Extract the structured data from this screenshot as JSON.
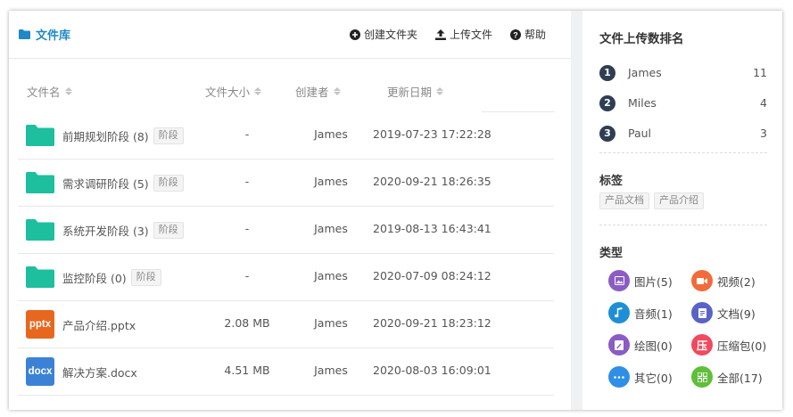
{
  "header": {
    "title": "文件库",
    "actions": {
      "create_folder": "创建文件夹",
      "upload": "上传文件",
      "help": "帮助"
    }
  },
  "table": {
    "columns": {
      "name": "文件名",
      "size": "文件大小",
      "owner": "创建者",
      "date": "更新日期"
    },
    "rows": [
      {
        "name": "前期规划阶段 (8)",
        "tag": "阶段",
        "size": "-",
        "owner": "James",
        "date": "2019-07-23 17:22:28",
        "icon": "folder-icon"
      },
      {
        "name": "需求调研阶段 (5)",
        "tag": "阶段",
        "size": "-",
        "owner": "James",
        "date": "2020-09-21 18:26:35",
        "icon": "folder-icon"
      },
      {
        "name": "系统开发阶段 (3)",
        "tag": "阶段",
        "size": "-",
        "owner": "James",
        "date": "2019-08-13 16:43:41",
        "icon": "folder-icon"
      },
      {
        "name": "监控阶段 (0)",
        "tag": "阶段",
        "size": "-",
        "owner": "James",
        "date": "2020-07-09 08:24:12",
        "icon": "folder-icon"
      },
      {
        "name": "产品介绍.pptx",
        "badge": "pptx",
        "size": "2.08 MB",
        "owner": "James",
        "date": "2020-09-21 18:23:12",
        "icon": "pptx-file-icon"
      },
      {
        "name": "解决方案.docx",
        "badge": "docx",
        "size": "4.51 MB",
        "owner": "James",
        "date": "2020-08-03 16:09:01",
        "icon": "docx-file-icon"
      }
    ]
  },
  "sidebar": {
    "ranking_title": "文件上传数排名",
    "ranking": [
      {
        "rank": "1",
        "name": "James",
        "count": "11"
      },
      {
        "rank": "2",
        "name": "Miles",
        "count": "4"
      },
      {
        "rank": "3",
        "name": "Paul",
        "count": "3"
      }
    ],
    "tags_title": "标签",
    "tags": [
      "产品文档",
      "产品介绍"
    ],
    "types_title": "类型",
    "types": [
      {
        "label": "图片(5)",
        "icon": "image-icon",
        "color": "#8b5cc4"
      },
      {
        "label": "视频(2)",
        "icon": "video-icon",
        "color": "#f26b3a"
      },
      {
        "label": "音频(1)",
        "icon": "music-icon",
        "color": "#1e8fd6"
      },
      {
        "label": "文档(9)",
        "icon": "document-icon",
        "color": "#5b62c7"
      },
      {
        "label": "绘图(0)",
        "icon": "drawing-icon",
        "color": "#8b5cc4"
      },
      {
        "label": "压缩包(0)",
        "icon": "archive-icon",
        "glyph": "压",
        "color": "#f04a5e"
      },
      {
        "label": "其它(0)",
        "icon": "more-icon",
        "color": "#2f8fe6"
      },
      {
        "label": "全部(17)",
        "icon": "all-icon",
        "color": "#5fbf3a"
      }
    ]
  },
  "colors": {
    "accent": "#1e88c8",
    "folder": "#1dbf9f",
    "pptx": "#e8671e",
    "docx": "#3b82d6",
    "rank_badge": "#2f3e52"
  }
}
